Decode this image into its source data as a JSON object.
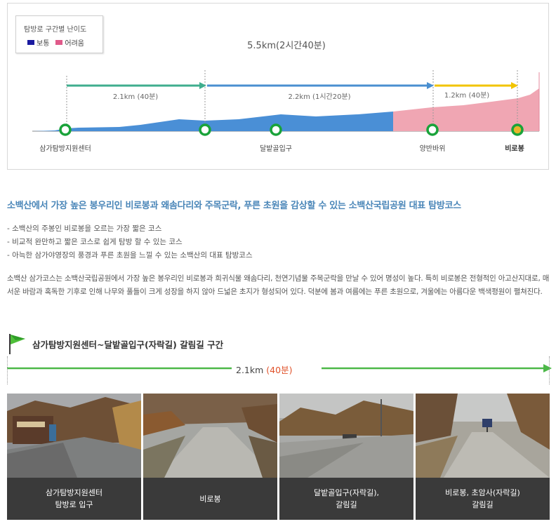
{
  "legend": {
    "title": "탐방로 구간별 난이도",
    "items": [
      {
        "label": "보통",
        "color": "#1a1aa0"
      },
      {
        "label": "어려움",
        "color": "#e05a8a"
      }
    ]
  },
  "course": {
    "total": "5.5km(2시간40분)",
    "segments": [
      {
        "label": "2.1km (40분)",
        "color": "#3fae8e"
      },
      {
        "label": "2.2km (1시간20분)",
        "color": "#4a8fd0"
      },
      {
        "label": "1.2km (40분)",
        "color": "#f2c400"
      }
    ],
    "points": [
      {
        "label": "삼가탐방지원센터"
      },
      {
        "label": ""
      },
      {
        "label": "달밭골입구"
      },
      {
        "label": "양반바위"
      },
      {
        "label": "비로봉"
      }
    ],
    "colors": {
      "normal": "#4a8fd6",
      "hard": "#f0a0ae",
      "marker": "#1aa33a",
      "summit": "#e8b62a"
    }
  },
  "headline": "소백산에서 가장 높은 봉우리인 비로봉과 왜솜다리와 주목군락, 푸른 초원을 감상할 수 있는 소백산국립공원 대표 탐방코스",
  "bullets": [
    "- 소백산의 주봉인 비로봉을 오르는 가장 짧은 코스",
    "- 비교적 완만하고 짧은 코스로 쉽게 탐방 할 수 있는 코스",
    "- 아늑한 삼가야영장의 풍경과 푸른 초원을 느낄 수 있는 소백산의 대표 탐방코스"
  ],
  "paragraph": "소백산 삼가코스는 소백산국립공원에서 가장 높은 봉우리인 비로봉과 희귀식물 왜솜다리, 천연기념물 주목군락을 만날 수 있어 명성이 높다. 특히 비로봉은 전형적인 아고산지대로, 매서운 바람과 혹독한 기후로 인해 나무와 풀들이 크게 성장을 하지 않아 드넓은 초지가 형성되어 있다. 덕분에 봄과 여름에는 푸른 초원으로, 겨울에는 아름다운 백색평원이 펼쳐진다.",
  "section": {
    "title": "삼가탐방지원센터~달밭골입구(자락길) 갈림길 구간",
    "distance": "2.1km",
    "time": "(40분)"
  },
  "photos": [
    {
      "caption": "삼가탐방지원센터\n탐방로 입구"
    },
    {
      "caption": "비로봉"
    },
    {
      "caption": "달밭골입구(자락길),\n갈림길"
    },
    {
      "caption": "비로봉, 초암사(자락길)\n갈림길"
    }
  ]
}
